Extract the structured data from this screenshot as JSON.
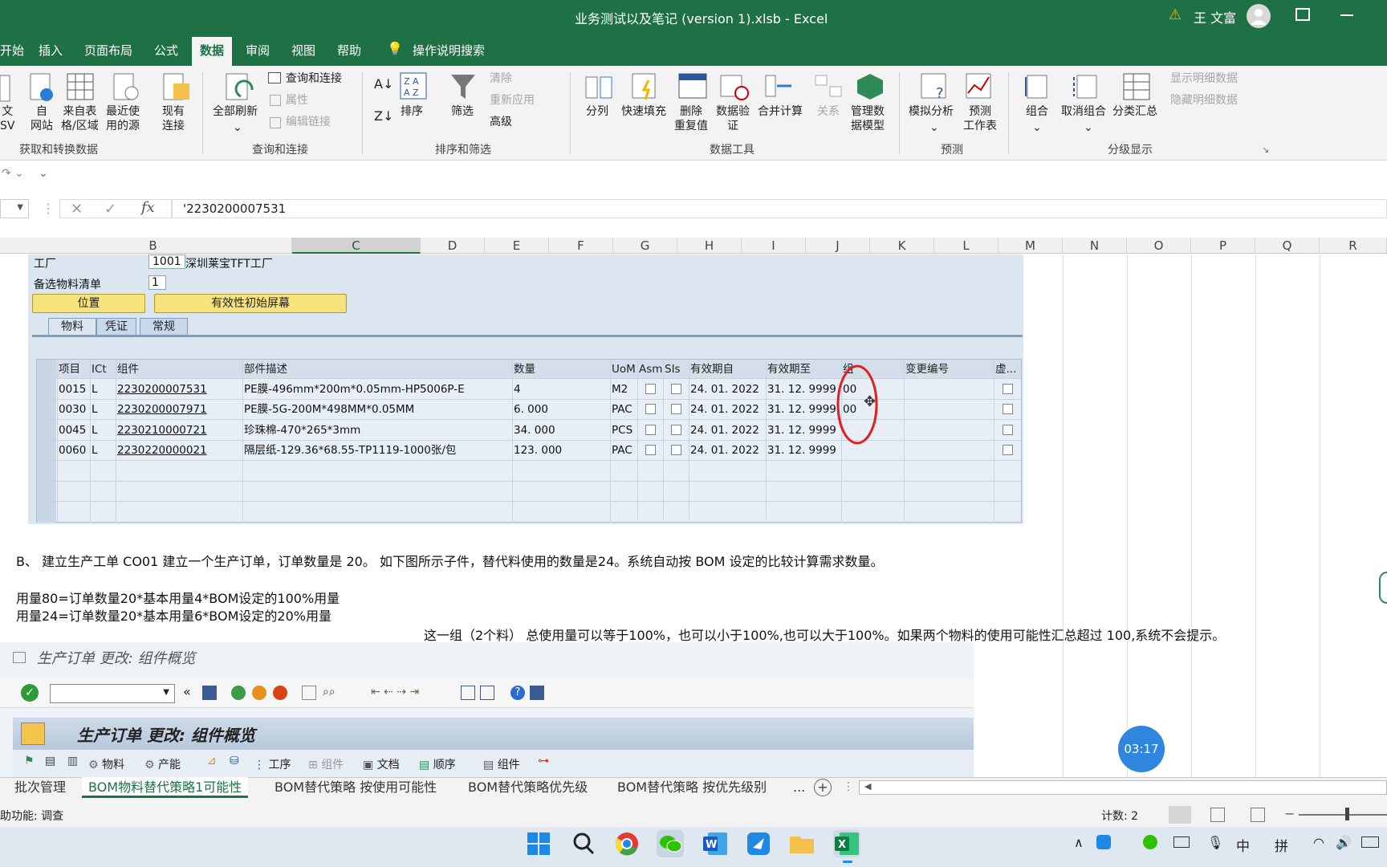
{
  "titlebar": {
    "title": "业务测试以及笔记 (version 1).xlsb  -  Excel",
    "user": "王 文富",
    "warning": "⚠"
  },
  "ribbon_tabs": [
    "开始",
    "插入",
    "页面布局",
    "公式",
    "数据",
    "审阅",
    "视图",
    "帮助",
    "操作说明搜索"
  ],
  "ribbon": {
    "g1": {
      "b1": "文\nSV",
      "b2": "自\n网站",
      "b3": "来自表\n格/区域",
      "b4": "最近使\n用的源",
      "b5": "现有\n连接",
      "label": "获取和转换数据"
    },
    "g2": {
      "refresh": "全部刷新",
      "q1": "查询和连接",
      "q2": "属性",
      "q3": "编辑链接",
      "label": "查询和连接"
    },
    "g3": {
      "sort": "排序",
      "filter": "筛选",
      "clear": "清除",
      "reapply": "重新应用",
      "adv": "高级",
      "label": "排序和筛选"
    },
    "g4": {
      "b1": "分列",
      "b2": "快速填充",
      "b3": "删除\n重复值",
      "b4": "数据验\n证",
      "b5": "合并计算",
      "b6": "关系",
      "b7": "管理数\n据模型",
      "label": "数据工具"
    },
    "g5": {
      "b1": "模拟分析",
      "b2": "预测\n工作表",
      "label": "预测"
    },
    "g6": {
      "b1": "组合",
      "b2": "取消组合",
      "b3": "分类汇总",
      "b4": "显示明细数据",
      "b5": "隐藏明细数据",
      "label": "分级显示"
    }
  },
  "formula": {
    "value": "'2230200007531",
    "fx": "fx"
  },
  "columns": [
    "B",
    "C",
    "D",
    "E",
    "F",
    "G",
    "H",
    "I",
    "J",
    "K",
    "L",
    "M",
    "N",
    "O",
    "P",
    "Q",
    "R"
  ],
  "sap1": {
    "plant_label": "工厂",
    "plant_code": "1001",
    "plant_name": "深圳莱宝TFT工厂",
    "alt_label": "备选物料清单",
    "alt_value": "1",
    "btn_pos": "位置",
    "btn_valid": "有效性初始屏幕",
    "tabs": [
      "物料",
      "凭证",
      "常规"
    ],
    "headers": [
      "项目",
      "ICt",
      "组件",
      "部件描述",
      "数量",
      "UoM",
      "Asm",
      "SIs",
      "有效期自",
      "有效期至",
      "组",
      "变更编号",
      "虚..."
    ],
    "rows": [
      {
        "item": "0015",
        "ict": "L",
        "comp": "2230200007531",
        "desc": "PE膜-496mm*200m*0.05mm-HP5006P-E",
        "qty": "4",
        "uom": "M2",
        "from": "24. 01. 2022",
        "to": "31. 12. 9999",
        "grp": "00"
      },
      {
        "item": "0030",
        "ict": "L",
        "comp": "2230200007971",
        "desc": "PE膜-5G-200M*498MM*0.05MM",
        "qty": "6. 000",
        "uom": "PAC",
        "from": "24. 01. 2022",
        "to": "31. 12. 9999",
        "grp": "00"
      },
      {
        "item": "0045",
        "ict": "L",
        "comp": "2230210000721",
        "desc": "珍珠棉-470*265*3mm",
        "qty": "34. 000",
        "uom": "PCS",
        "from": "24. 01. 2022",
        "to": "31. 12. 9999",
        "grp": ""
      },
      {
        "item": "0060",
        "ict": "L",
        "comp": "2230220000021",
        "desc": "隔层纸-129.36*68.55-TP1119-1000张/包",
        "qty": "123. 000",
        "uom": "PAC",
        "from": "24. 01. 2022",
        "to": "31. 12. 9999",
        "grp": ""
      }
    ]
  },
  "notes": {
    "line1": "B、 建立生产工单 CO01 建立一个生产订单，订单数量是 20。 如下图所示子件，替代料使用的数量是24。系统自动按 BOM 设定的比较计算需求数量。",
    "line2": "用量80=订单数量20*基本用量4*BOM设定的100%用量",
    "line3": "用量24=订单数量20*基本用量6*BOM设定的20%用量",
    "line4": "这一组（2个料） 总使用量可以等于100%，也可以小于100%,也可以大于100%。如果两个物料的使用可能性汇总超过 100,系统不会提示。"
  },
  "sap2": {
    "title": "生产订单 更改: 组件概览",
    "banner": "生产订单 更改: 组件概览",
    "bar": [
      "物料",
      "产能",
      "工序",
      "组件",
      "文档",
      "顺序",
      "组件"
    ]
  },
  "timer": "03:17",
  "sheet_tabs": [
    "批次管理",
    "BOM物料替代策略1可能性",
    "BOM替代策略 按使用可能性",
    "BOM替代策略优先级",
    "BOM替代策略 按优先级别",
    "..."
  ],
  "status": {
    "left": "助功能: 调查",
    "count": "计数: 2"
  },
  "taskbar": {
    "tray1": "中",
    "tray2": "拼"
  }
}
